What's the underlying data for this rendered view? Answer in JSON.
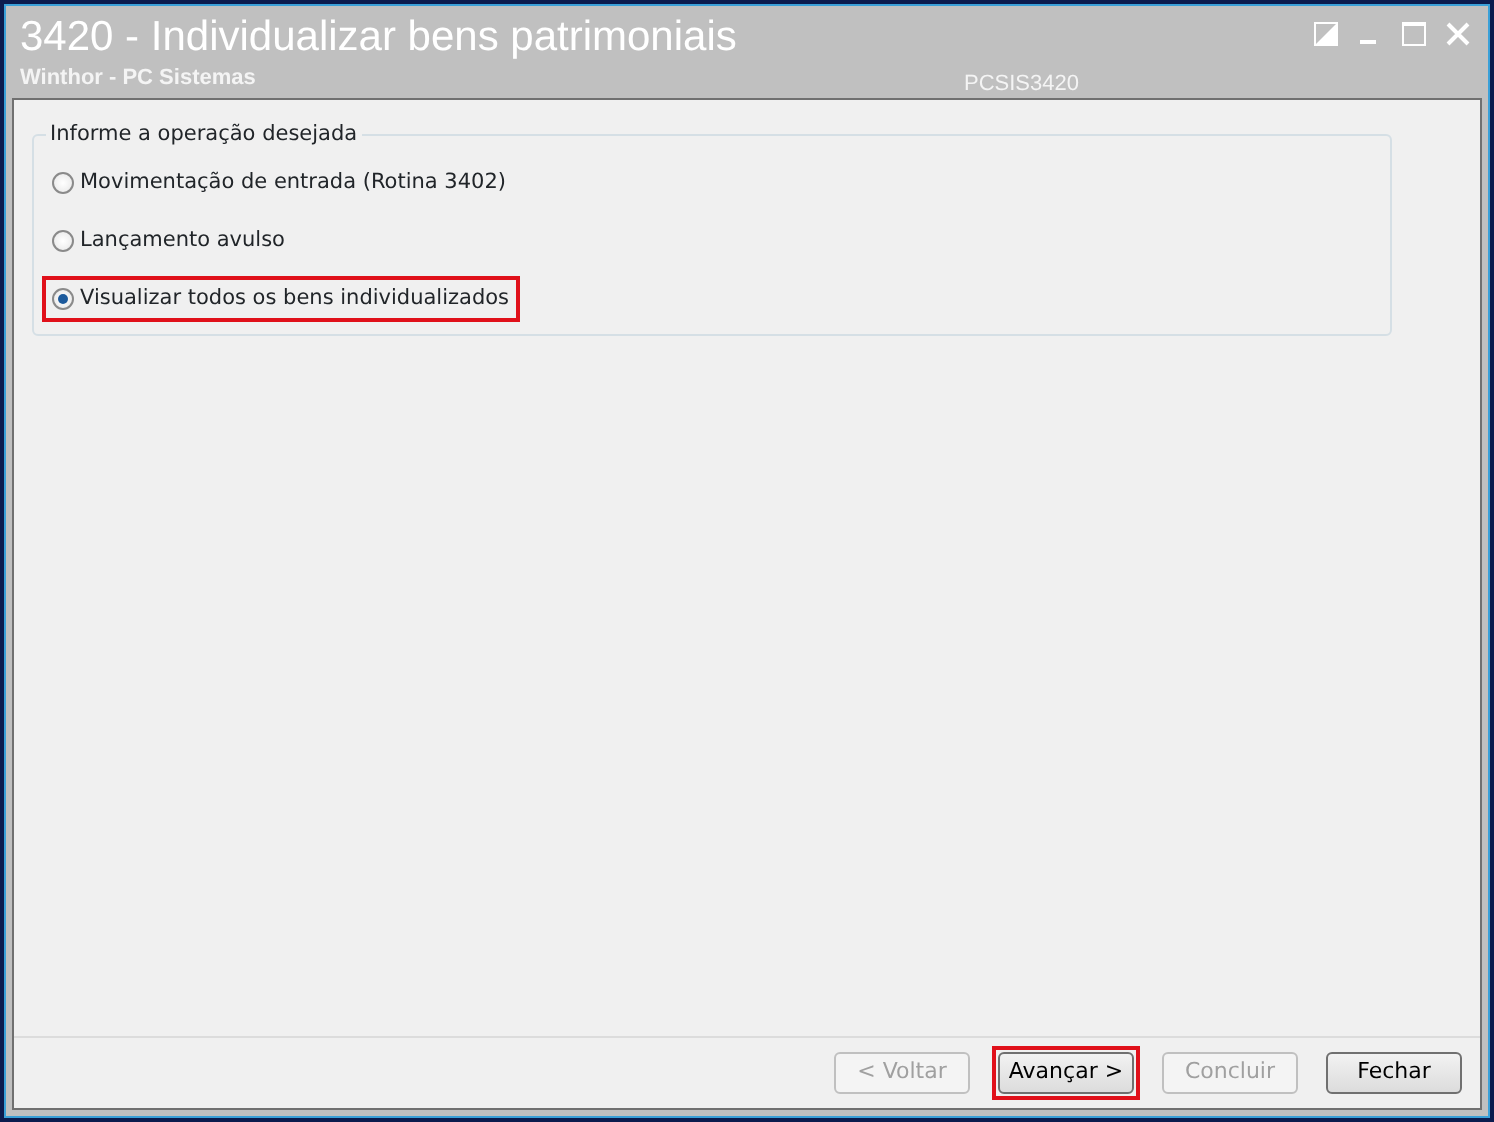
{
  "window": {
    "title": "3420 - Individualizar bens patrimoniais",
    "subtitle": "Winthor - PC Sistemas",
    "code": "PCSIS3420"
  },
  "group": {
    "label": "Informe a operação desejada",
    "options": [
      {
        "label": "Movimentação de entrada (Rotina 3402)",
        "selected": false,
        "highlighted": false
      },
      {
        "label": "Lançamento avulso",
        "selected": false,
        "highlighted": false
      },
      {
        "label": "Visualizar todos os bens individualizados",
        "selected": true,
        "highlighted": true
      }
    ]
  },
  "buttons": [
    {
      "label": "< Voltar",
      "disabled": true,
      "highlighted": false
    },
    {
      "label": "Avançar >",
      "disabled": false,
      "highlighted": true
    },
    {
      "label": "Concluir",
      "disabled": true,
      "highlighted": false
    },
    {
      "label": "Fechar",
      "disabled": false,
      "highlighted": false
    }
  ]
}
